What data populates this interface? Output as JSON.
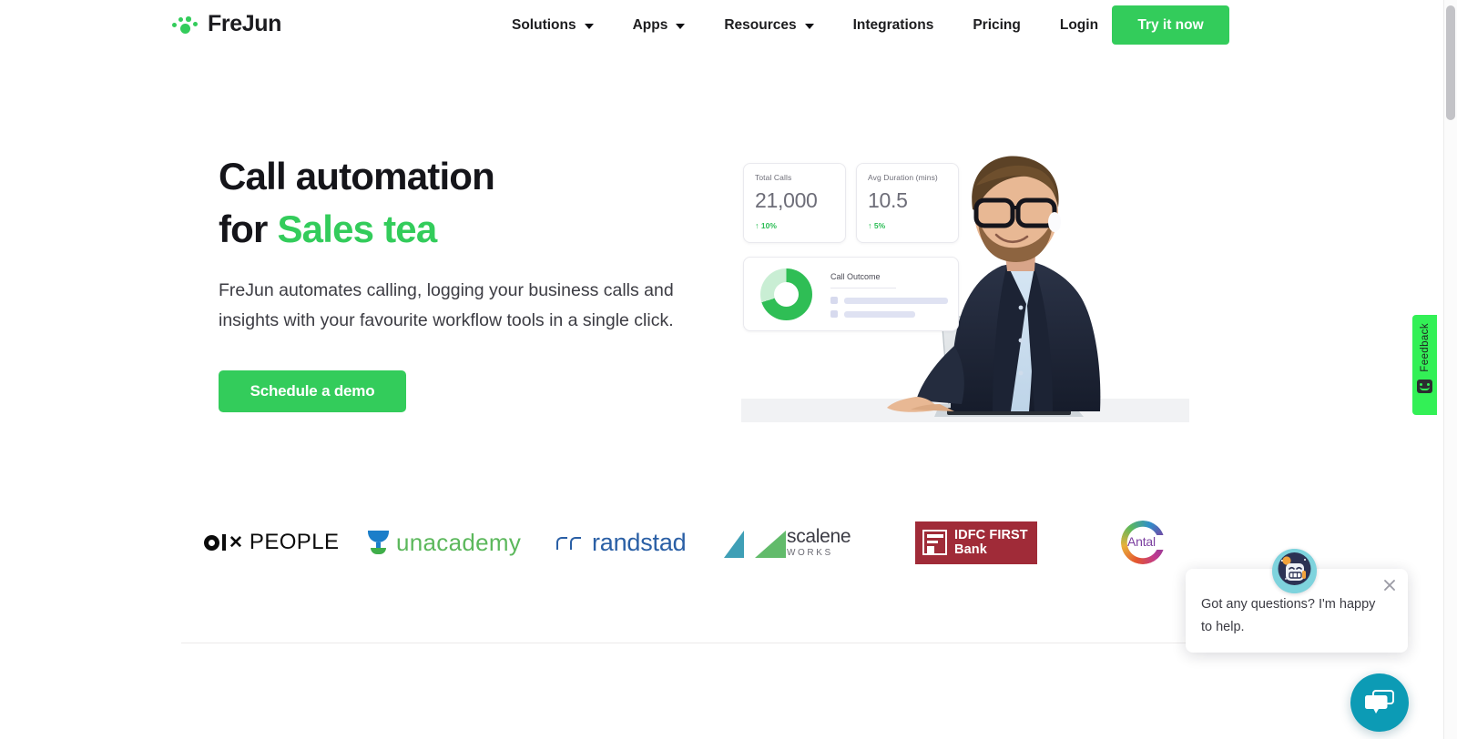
{
  "brand": {
    "name": "FreJun",
    "logo_icon": "frejun-dots-logo",
    "green": "#33CC5B",
    "dark": "#15151a"
  },
  "header": {
    "nav_items": [
      {
        "label": "Solutions",
        "has_dropdown": true,
        "icon": "chevron-down-icon"
      },
      {
        "label": "Apps",
        "has_dropdown": true,
        "icon": "chevron-down-icon"
      },
      {
        "label": "Resources",
        "has_dropdown": true,
        "icon": "chevron-down-icon"
      },
      {
        "label": "Integrations",
        "has_dropdown": false
      },
      {
        "label": "Pricing",
        "has_dropdown": false
      },
      {
        "label": "Login",
        "has_dropdown": false
      }
    ],
    "cta_label": "Try it now"
  },
  "hero": {
    "title_line1": "Call automation",
    "title_line2_static": "for ",
    "title_line2_accent": "Sales tea",
    "paragraph": "FreJun automates calling, logging your business calls and insights with your favourite workflow tools in a single click.",
    "cta_label": "Schedule a demo"
  },
  "dashboard": {
    "stats": [
      {
        "label": "Total Calls",
        "value": "21,000",
        "delta": "10%",
        "delta_arrow": "↑",
        "delta_color": "#2bbd55"
      },
      {
        "label": "Avg Duration (mins)",
        "value": "10.5",
        "delta": "5%",
        "delta_arrow": "↑",
        "delta_color": "#2bbd55"
      }
    ],
    "outcome_card": {
      "title": "Call Outcome",
      "donut_icon": "donut-chart-icon",
      "donut_primary_pct": 70,
      "donut_secondary_pct": 30,
      "donut_primary_color": "#2fbe55",
      "donut_secondary_color": "#c9eed4"
    },
    "photo_alt": "man-with-glasses-typing-on-laptop"
  },
  "logos": {
    "items": [
      {
        "name": "OLX PEOPLE",
        "word_a": "PEOPLE",
        "x_glyph": "✕"
      },
      {
        "name": "unacademy",
        "text": "unacademy"
      },
      {
        "name": "randstad",
        "text": "randstad"
      },
      {
        "name": "scaleneWORKS",
        "text_a": "scalene",
        "text_b": "WORKS"
      },
      {
        "name": "IDFC FIRST Bank",
        "line1": "IDFC FIRST",
        "line2": "Bank"
      },
      {
        "name": "Antal",
        "text": "Antal"
      }
    ]
  },
  "feedback": {
    "label": "Feedback",
    "icon": "smiley-face-icon",
    "bg_color": "#33F056"
  },
  "chat": {
    "message": "Got any questions? I'm happy to help.",
    "close_icon": "close-icon",
    "avatar_icon": "robot-avatar-icon",
    "launcher_icon": "chat-bubble-icon",
    "launcher_color": "#0C9BB5"
  },
  "scrollbar": {
    "thumb_position": "top",
    "visible": true
  }
}
